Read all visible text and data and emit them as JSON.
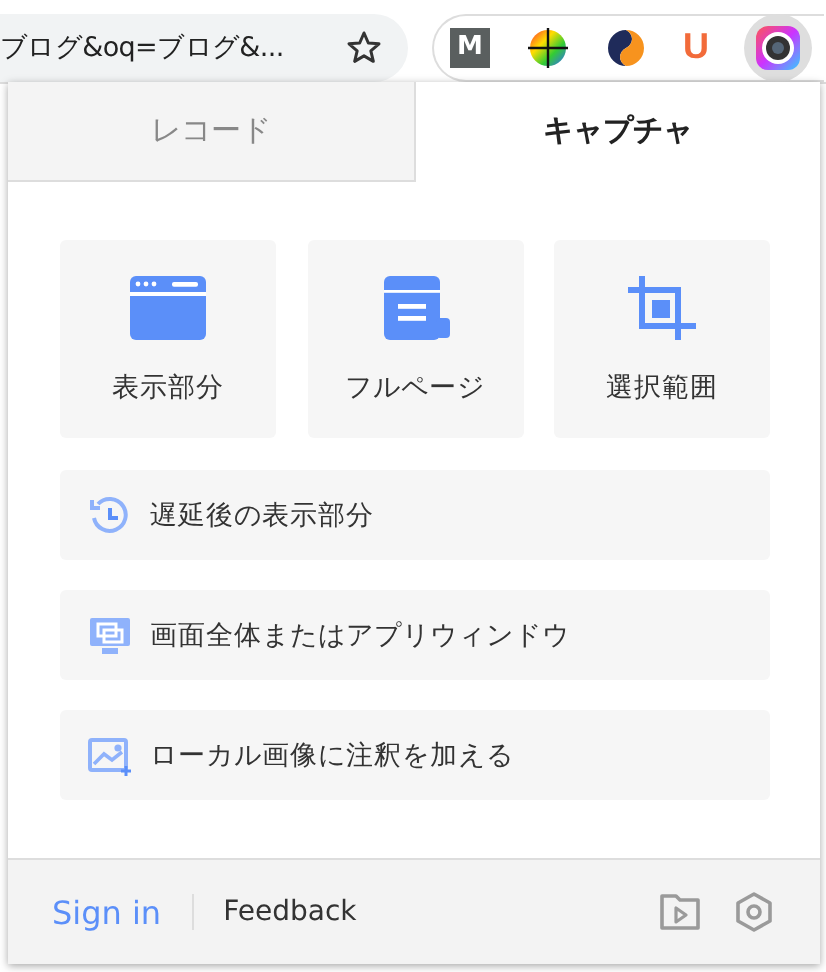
{
  "browser": {
    "address": "ブログ&oq=ブログ&...",
    "extensions": [
      {
        "kind": "letter",
        "label": "M"
      },
      {
        "kind": "wheel"
      },
      {
        "kind": "swirl"
      },
      {
        "kind": "text-logo",
        "label": "U"
      },
      {
        "kind": "lens",
        "selected": true
      }
    ]
  },
  "tabs": [
    {
      "label": "レコード",
      "selected": false
    },
    {
      "label": "キャプチャ",
      "selected": true
    }
  ],
  "cards": [
    {
      "kind": "window",
      "label": "表示部分"
    },
    {
      "kind": "scroll",
      "label": "フルページ"
    },
    {
      "kind": "crop",
      "label": "選択範囲"
    }
  ],
  "options": [
    {
      "kind": "delay",
      "label": "遅延後の表示部分"
    },
    {
      "kind": "screen",
      "label": "画面全体またはアプリウィンドウ"
    },
    {
      "kind": "image",
      "label": "ローカル画像に注釈を加える"
    }
  ],
  "footer": {
    "sign_in": "Sign in",
    "feedback": "Feedback"
  }
}
